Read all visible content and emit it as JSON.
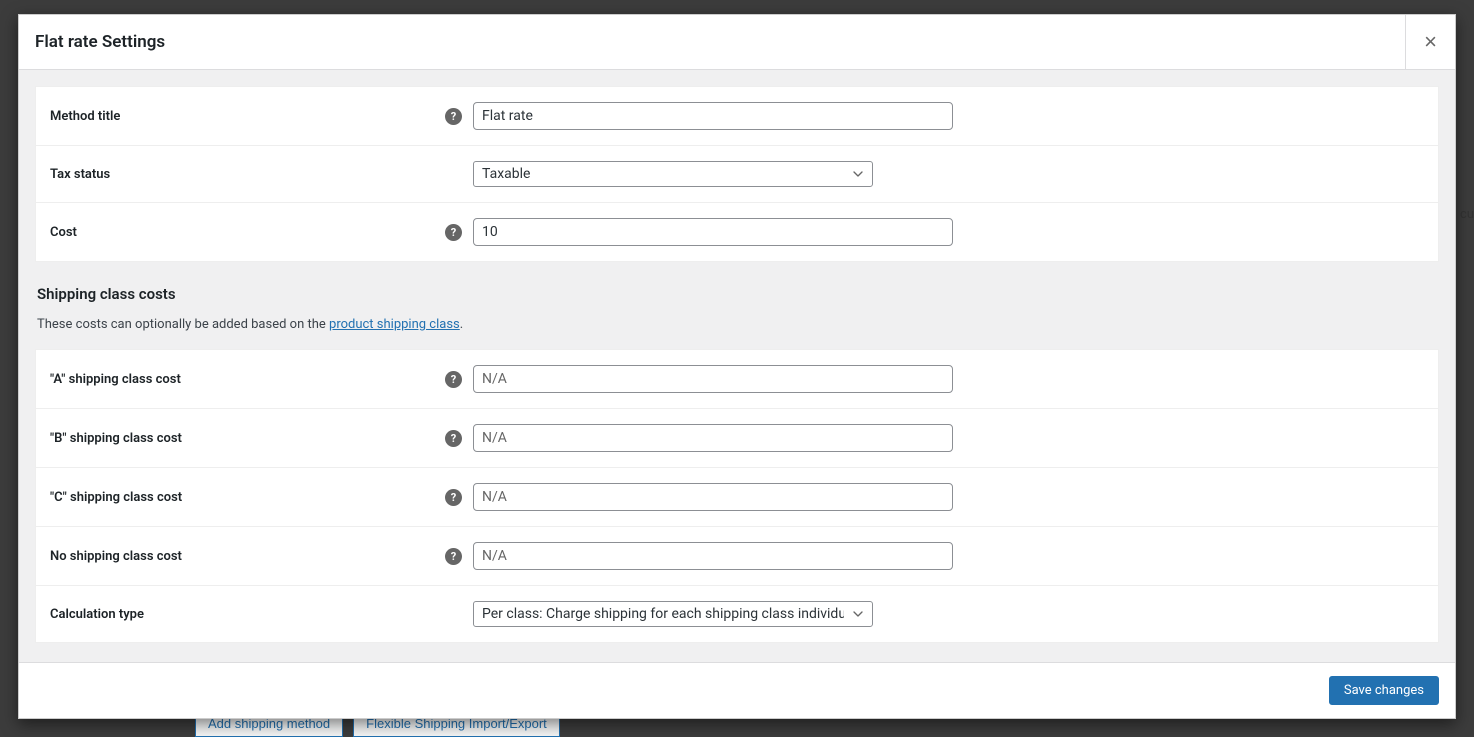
{
  "modal": {
    "title": "Flat rate Settings",
    "closeLabel": "×"
  },
  "fields": {
    "methodTitle": {
      "label": "Method title",
      "value": "Flat rate"
    },
    "taxStatus": {
      "label": "Tax status",
      "selected": "Taxable"
    },
    "cost": {
      "label": "Cost",
      "value": "10"
    }
  },
  "shippingClassSection": {
    "heading": "Shipping class costs",
    "descPrefix": "These costs can optionally be added based on the ",
    "linkText": "product shipping class",
    "descSuffix": "."
  },
  "classFields": {
    "a": {
      "label": "\"A\" shipping class cost",
      "placeholder": "N/A",
      "value": ""
    },
    "b": {
      "label": "\"B\" shipping class cost",
      "placeholder": "N/A",
      "value": ""
    },
    "c": {
      "label": "\"C\" shipping class cost",
      "placeholder": "N/A",
      "value": ""
    },
    "none": {
      "label": "No shipping class cost",
      "placeholder": "N/A",
      "value": ""
    },
    "calcType": {
      "label": "Calculation type",
      "selected": "Per class: Charge shipping for each shipping class individually"
    }
  },
  "footer": {
    "saveLabel": "Save changes"
  },
  "background": {
    "addMethod": "Add shipping method",
    "importExport": "Flexible Shipping Import/Export",
    "cu": "cu"
  }
}
